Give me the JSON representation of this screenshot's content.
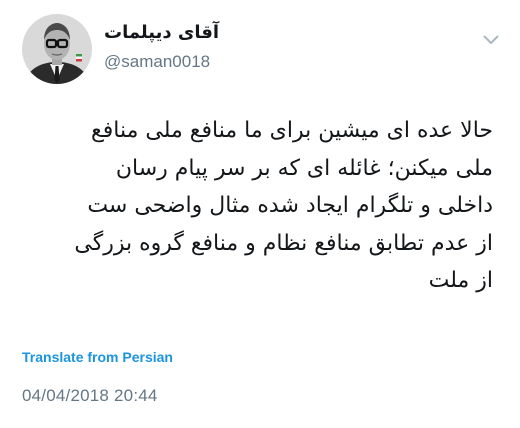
{
  "author": {
    "display_name": "آقای دیپلمات",
    "handle": "@saman0018"
  },
  "tweet": {
    "text_lines": [
      "حالا عده ای میشین برای ما منافع ملی منافع",
      "ملی میکنن؛ غائله ای که بر سر پیام رسان",
      "داخلی و تلگرام ایجاد شده مثال واضحی ست",
      "از عدم تطابق منافع نظام و منافع گروه بزرگی",
      "از ملت"
    ],
    "translate_label": "Translate from Persian",
    "timestamp": "04/04/2018 20:44"
  },
  "icons": {
    "avatar": "profile-photo",
    "menu": "chevron-down-icon"
  },
  "colors": {
    "link": "#1b95e0",
    "secondary_text": "#657786",
    "primary_text": "#14171a"
  }
}
